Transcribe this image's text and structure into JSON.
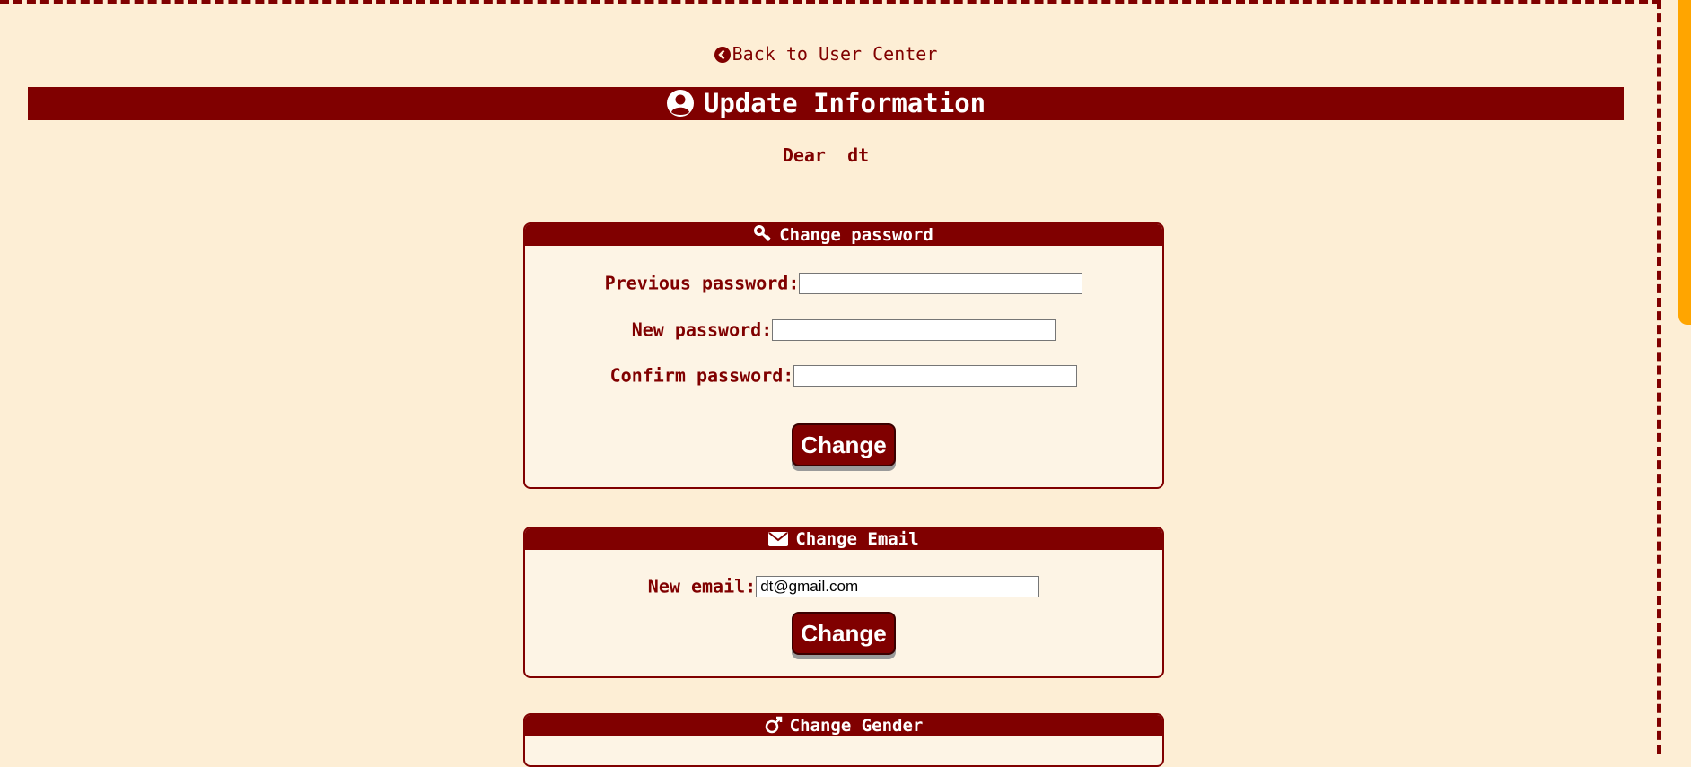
{
  "back_link": {
    "label": "Back to User Center",
    "icon": "chevron-left-circle-icon"
  },
  "page": {
    "title": "Update Information",
    "title_icon": "user-circle-icon"
  },
  "greeting": {
    "salutation": "Dear",
    "username": "dt"
  },
  "password_section": {
    "title": "Change password",
    "icon": "key-icon",
    "fields": [
      {
        "label": "Previous password:",
        "value": ""
      },
      {
        "label": "New password:",
        "value": ""
      },
      {
        "label": "Confirm password:",
        "value": ""
      }
    ],
    "button_label": "Change"
  },
  "email_section": {
    "title": "Change Email",
    "icon": "envelope-icon",
    "field_label": "New email:",
    "value": "dt@gmail.com",
    "button_label": "Change"
  },
  "gender_section": {
    "title": "Change Gender",
    "icon": "gender-icon"
  },
  "colors": {
    "primary": "#800000",
    "background": "#fdeed5",
    "scroll_accent": "#ffa500"
  }
}
